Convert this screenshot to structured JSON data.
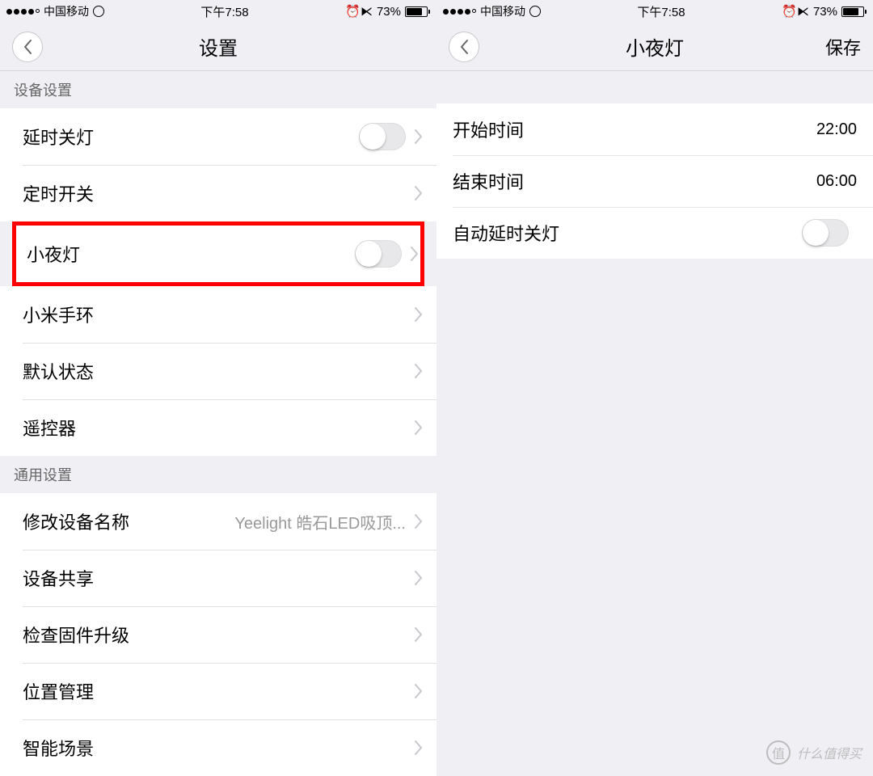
{
  "status": {
    "carrier": "中国移动",
    "time": "下午7:58",
    "battery_pct": "73%"
  },
  "left": {
    "title": "设置",
    "sections": {
      "device": {
        "header": "设备设置",
        "rows": {
          "delay_off": "延时关灯",
          "timer": "定时开关",
          "nightlight": "小夜灯",
          "mi_band": "小米手环",
          "default_state": "默认状态",
          "remote": "遥控器"
        }
      },
      "general": {
        "header": "通用设置",
        "rows": {
          "rename": {
            "label": "修改设备名称",
            "value": "Yeelight 皓石LED吸顶..."
          },
          "share": "设备共享",
          "firmware": "检查固件升级",
          "position": "位置管理",
          "scene": "智能场景"
        }
      }
    }
  },
  "right": {
    "title": "小夜灯",
    "save": "保存",
    "rows": {
      "start": {
        "label": "开始时间",
        "value": "22:00"
      },
      "end": {
        "label": "结束时间",
        "value": "06:00"
      },
      "auto_delay": "自动延时关灯"
    }
  },
  "watermark": {
    "badge": "值",
    "text": "什么值得买"
  }
}
